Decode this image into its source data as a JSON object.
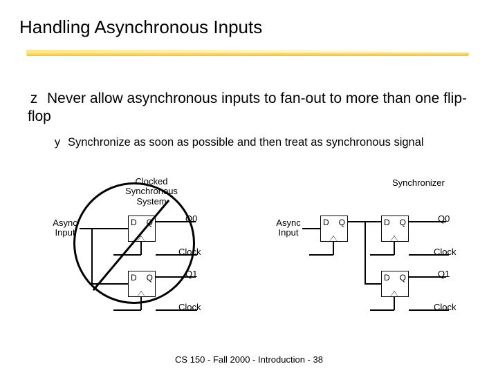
{
  "title": "Handling Asynchronous Inputs",
  "bullets": {
    "b1": "Never allow asynchronous inputs to fan-out to more than one flip-flop",
    "b2": "Synchronize as soon as possible and then treat as synchronous signal"
  },
  "labels": {
    "clocked_sys": "Clocked\nSynchronous\nSystem",
    "async_input": "Async\nInput",
    "synchronizer": "Synchronizer",
    "q0": "Q0",
    "q1": "Q1",
    "clock": "Clock",
    "d": "D",
    "q": "Q"
  },
  "footer": "CS 150 - Fall 2000 - Introduction - 38"
}
